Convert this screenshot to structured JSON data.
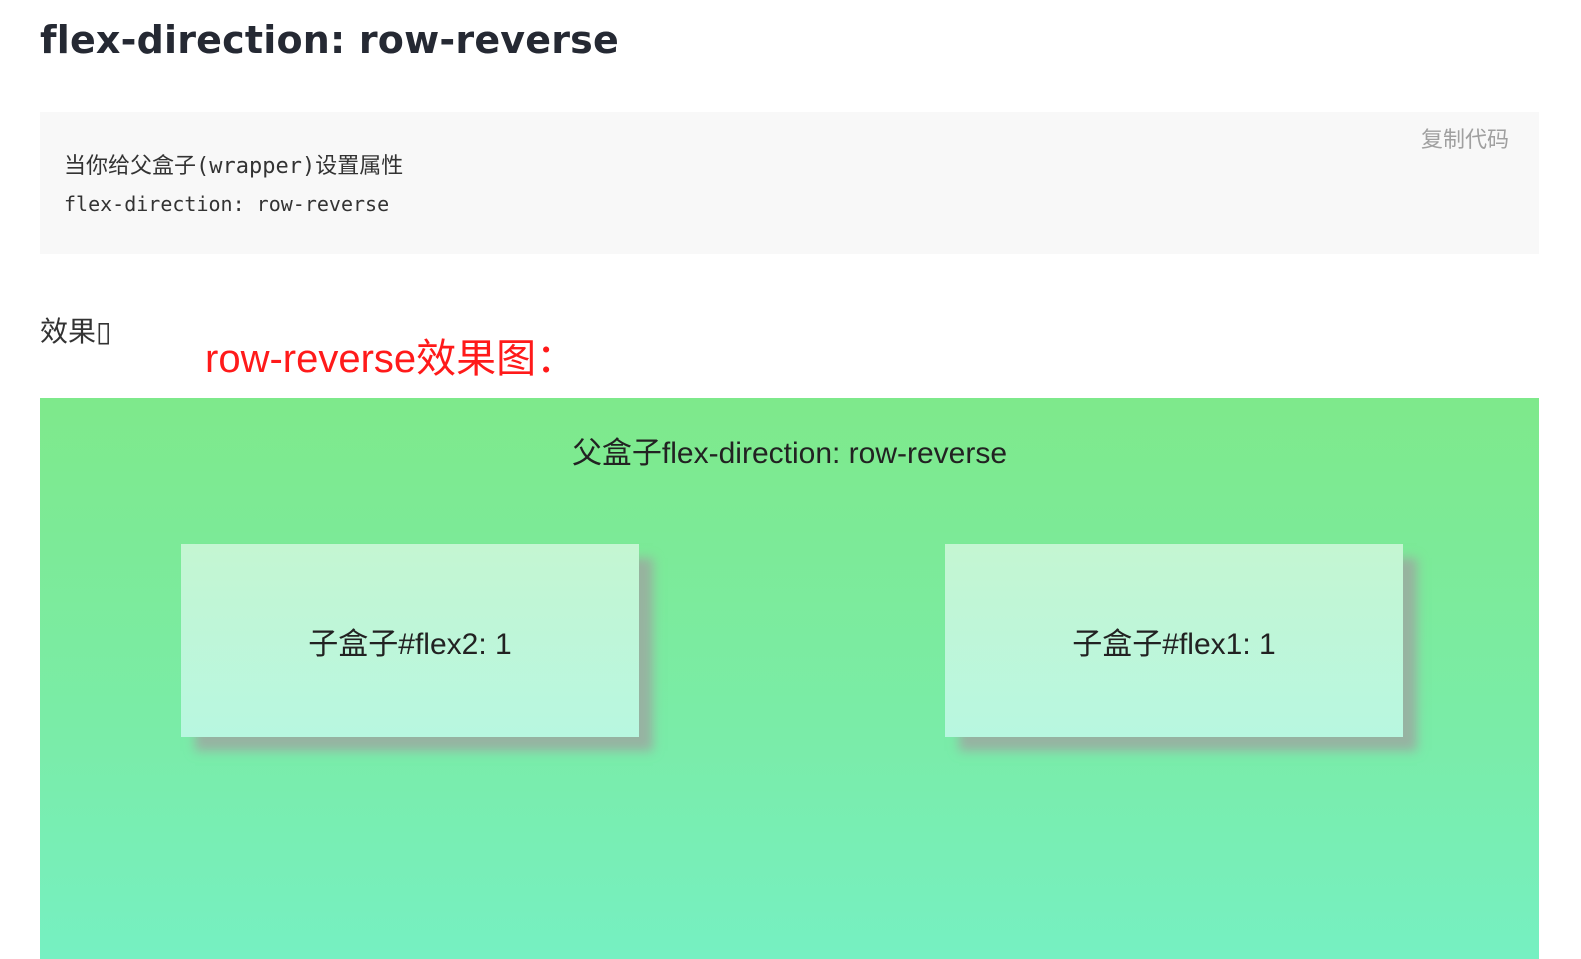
{
  "heading": "flex-direction: row-reverse",
  "code_block": {
    "copy_label": "复制代码",
    "lines": [
      "当你给父盒子(wrapper)设置属性",
      "flex-direction: row-reverse"
    ]
  },
  "effect": {
    "label": "效果▯",
    "caption": "row-reverse效果图："
  },
  "demo": {
    "parent_title": "父盒子flex-direction: row-reverse",
    "children": [
      {
        "label": "子盒子#flex2: 1"
      },
      {
        "label": "子盒子#flex1: 1"
      }
    ],
    "colors": {
      "parent_gradient_top": "#7ee98b",
      "parent_gradient_bottom": "#76f0c2",
      "child_gradient_top": "#c4f6d2",
      "child_gradient_bottom": "#b8f7e0",
      "caption": "#ff1a1a"
    }
  }
}
